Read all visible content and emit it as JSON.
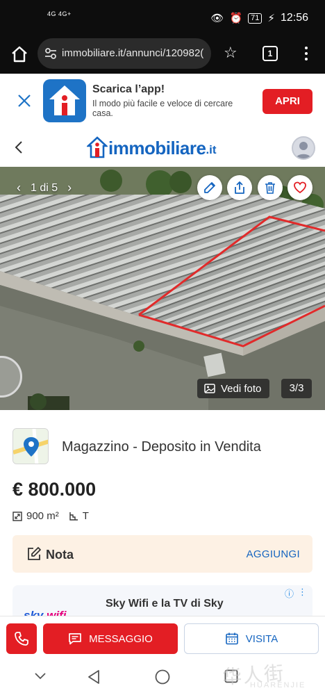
{
  "status_bar": {
    "network": "4G  4G+",
    "battery": "71",
    "time": "12:56"
  },
  "browser": {
    "url": "immobiliare.it/annunci/120982(",
    "tab_count": "1"
  },
  "app_banner": {
    "title": "Scarica l’app!",
    "subtitle": "Il modo più facile e veloce di cercare casa.",
    "open_label": "APRI"
  },
  "header": {
    "logo_main": "immobiliare",
    "logo_suffix": ".it"
  },
  "gallery": {
    "counter": "1 di 5",
    "vedi_foto": "Vedi foto",
    "photo_count": "3/3"
  },
  "listing": {
    "title": "Magazzino - Deposito in Vendita",
    "price": "€ 800.000",
    "surface": "900 m²",
    "floor": "T"
  },
  "note": {
    "label": "Nota",
    "action": "AGGIUNGI"
  },
  "ad": {
    "title": "Sky Wifi e la TV di Sky",
    "logo_sky": "sky",
    "logo_wifi": "wifi"
  },
  "actions": {
    "message": "MESSAGGIO",
    "visit": "VISITA"
  },
  "watermark": {
    "cn": "华人街",
    "en": "HUARENJIE"
  },
  "colors": {
    "brand_red": "#e31e24",
    "brand_blue": "#1565c0",
    "note_bg": "#fdf1e4",
    "border_highlight": "#e12a2a"
  }
}
